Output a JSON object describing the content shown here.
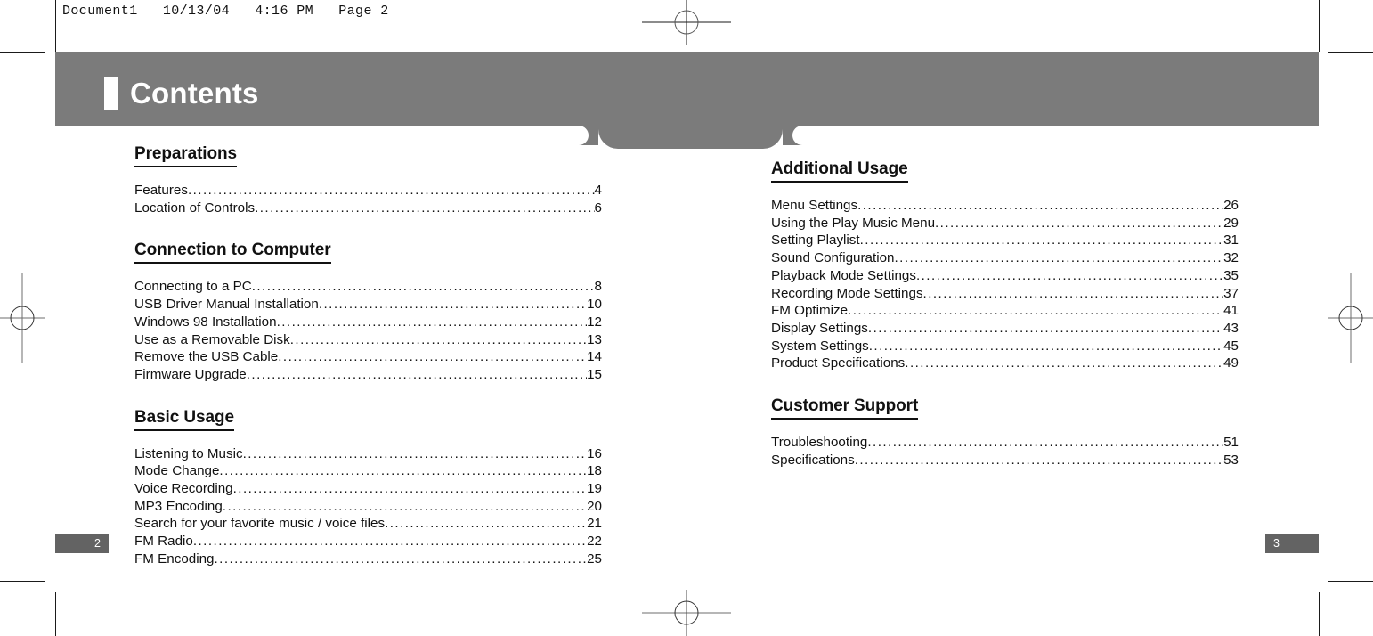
{
  "proof_slug": "Document1   10/13/04   4:16 PM   Page 2",
  "banner": {
    "title": "Contents"
  },
  "folio": {
    "left_page": "2",
    "right_page": "3"
  },
  "leader_dots": "..........................................................................................................................................................................................",
  "columns": {
    "left": [
      {
        "heading": "Preparations",
        "entries": [
          {
            "title": "Features",
            "page": "4"
          },
          {
            "title": "Location of Controls",
            "page": "6"
          }
        ]
      },
      {
        "heading": "Connection to Computer",
        "entries": [
          {
            "title": "Connecting to a PC",
            "page": "8"
          },
          {
            "title": "USB Driver Manual Installation",
            "page": "10"
          },
          {
            "title": "Windows 98 Installation",
            "page": "12"
          },
          {
            "title": "Use as a Removable Disk",
            "page": "13"
          },
          {
            "title": "Remove the USB Cable",
            "page": "14"
          },
          {
            "title": "Firmware Upgrade",
            "page": "15"
          }
        ]
      },
      {
        "heading": "Basic Usage",
        "entries": [
          {
            "title": "Listening to Music",
            "page": "16"
          },
          {
            "title": "Mode Change",
            "page": "18"
          },
          {
            "title": "Voice Recording",
            "page": "19"
          },
          {
            "title": "MP3 Encoding",
            "page": "20"
          },
          {
            "title": "Search for your favorite music / voice files",
            "page": "21"
          },
          {
            "title": "FM Radio",
            "page": "22"
          },
          {
            "title": "FM Encoding",
            "page": "25"
          }
        ]
      }
    ],
    "right": [
      {
        "heading": "Additional Usage",
        "entries": [
          {
            "title": "Menu Settings",
            "page": "26"
          },
          {
            "title": "Using the Play Music Menu",
            "page": "29"
          },
          {
            "title": "Setting Playlist",
            "page": "31"
          },
          {
            "title": "Sound Configuration",
            "page": "32"
          },
          {
            "title": "Playback Mode Settings",
            "page": "35"
          },
          {
            "title": "Recording Mode Settings",
            "page": "37"
          },
          {
            "title": "FM Optimize",
            "page": "41"
          },
          {
            "title": "Display Settings",
            "page": "43"
          },
          {
            "title": "System Settings",
            "page": "45"
          },
          {
            "title": "Product Specifications",
            "page": "49"
          }
        ]
      },
      {
        "heading": "Customer Support",
        "entries": [
          {
            "title": "Troubleshooting",
            "page": "51"
          },
          {
            "title": "Specifications",
            "page": "53"
          }
        ]
      }
    ]
  },
  "colors": {
    "banner_gray": "#7b7b7b",
    "folio_gray": "#636363",
    "text": "#111111"
  }
}
